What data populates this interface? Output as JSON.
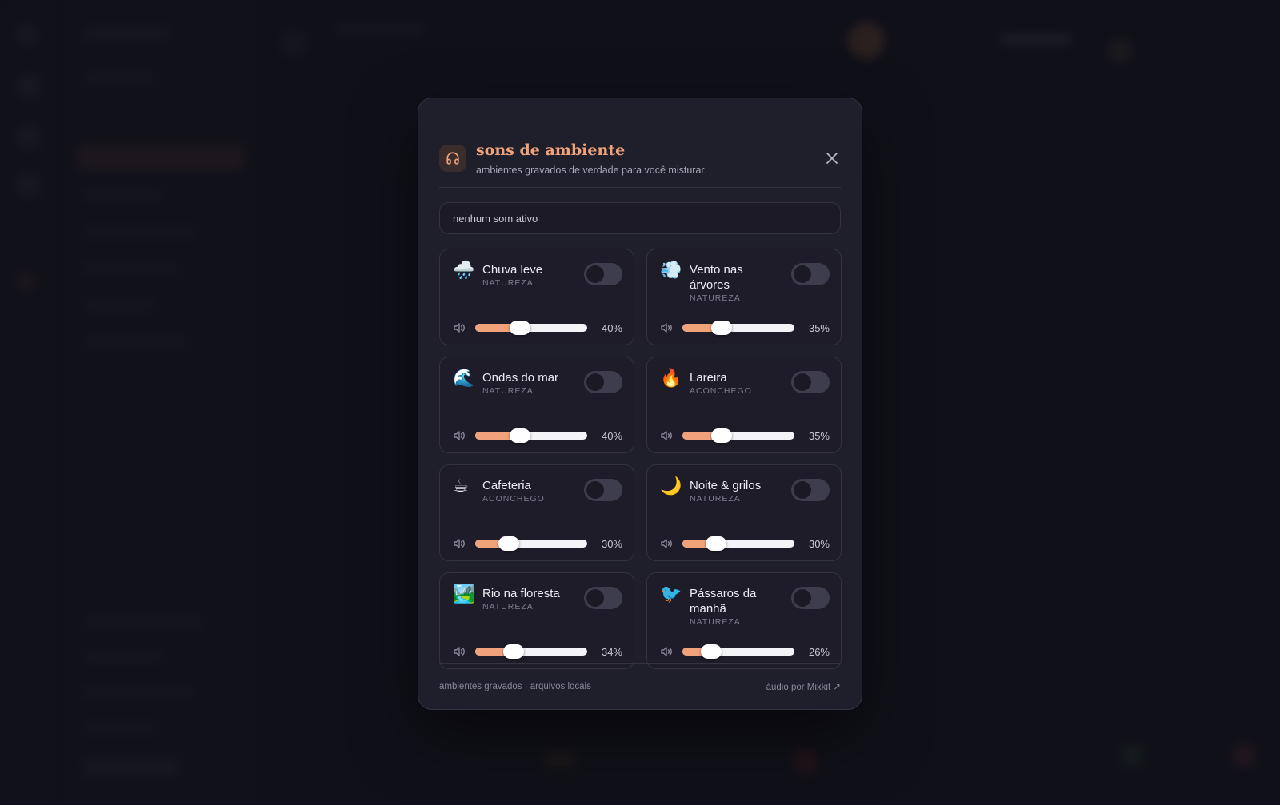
{
  "dialog": {
    "title": "sons de ambiente",
    "subtitle": "ambientes gravados de verdade para você misturar",
    "status": "nenhum som ativo",
    "footer_left": "ambientes gravados · arquivos locais",
    "footer_right": "áudio por Mixkit ↗"
  },
  "colors": {
    "accent": "#f0a27a",
    "dialog_bg": "#1f1e2b",
    "card_bg": "#1d1c28",
    "border": "#34333f",
    "toggle_off": "#3e3d4d"
  },
  "sounds": [
    {
      "emoji": "🌧️",
      "icon": "rain-cloud-icon",
      "name": "Chuva leve",
      "category": "NATUREZA",
      "enabled": false,
      "volume": 40,
      "volume_label": "40%"
    },
    {
      "emoji": "💨",
      "icon": "wind-icon",
      "name": "Vento nas árvores",
      "category": "NATUREZA",
      "enabled": false,
      "volume": 35,
      "volume_label": "35%"
    },
    {
      "emoji": "🌊",
      "icon": "wave-icon",
      "name": "Ondas do mar",
      "category": "NATUREZA",
      "enabled": false,
      "volume": 40,
      "volume_label": "40%"
    },
    {
      "emoji": "🔥",
      "icon": "fire-icon",
      "name": "Lareira",
      "category": "ACONCHEGO",
      "enabled": false,
      "volume": 35,
      "volume_label": "35%"
    },
    {
      "emoji": "☕",
      "icon": "coffee-icon",
      "name": "Cafeteria",
      "category": "ACONCHEGO",
      "enabled": false,
      "volume": 30,
      "volume_label": "30%"
    },
    {
      "emoji": "🌙",
      "icon": "moon-icon",
      "name": "Noite & grilos",
      "category": "NATUREZA",
      "enabled": false,
      "volume": 30,
      "volume_label": "30%"
    },
    {
      "emoji": "🏞️",
      "icon": "river-landscape-icon",
      "name": "Rio na floresta",
      "category": "NATUREZA",
      "enabled": false,
      "volume": 34,
      "volume_label": "34%"
    },
    {
      "emoji": "🐦",
      "icon": "bird-icon",
      "name": "Pássaros da manhã",
      "category": "NATUREZA",
      "enabled": false,
      "volume": 26,
      "volume_label": "26%"
    }
  ]
}
